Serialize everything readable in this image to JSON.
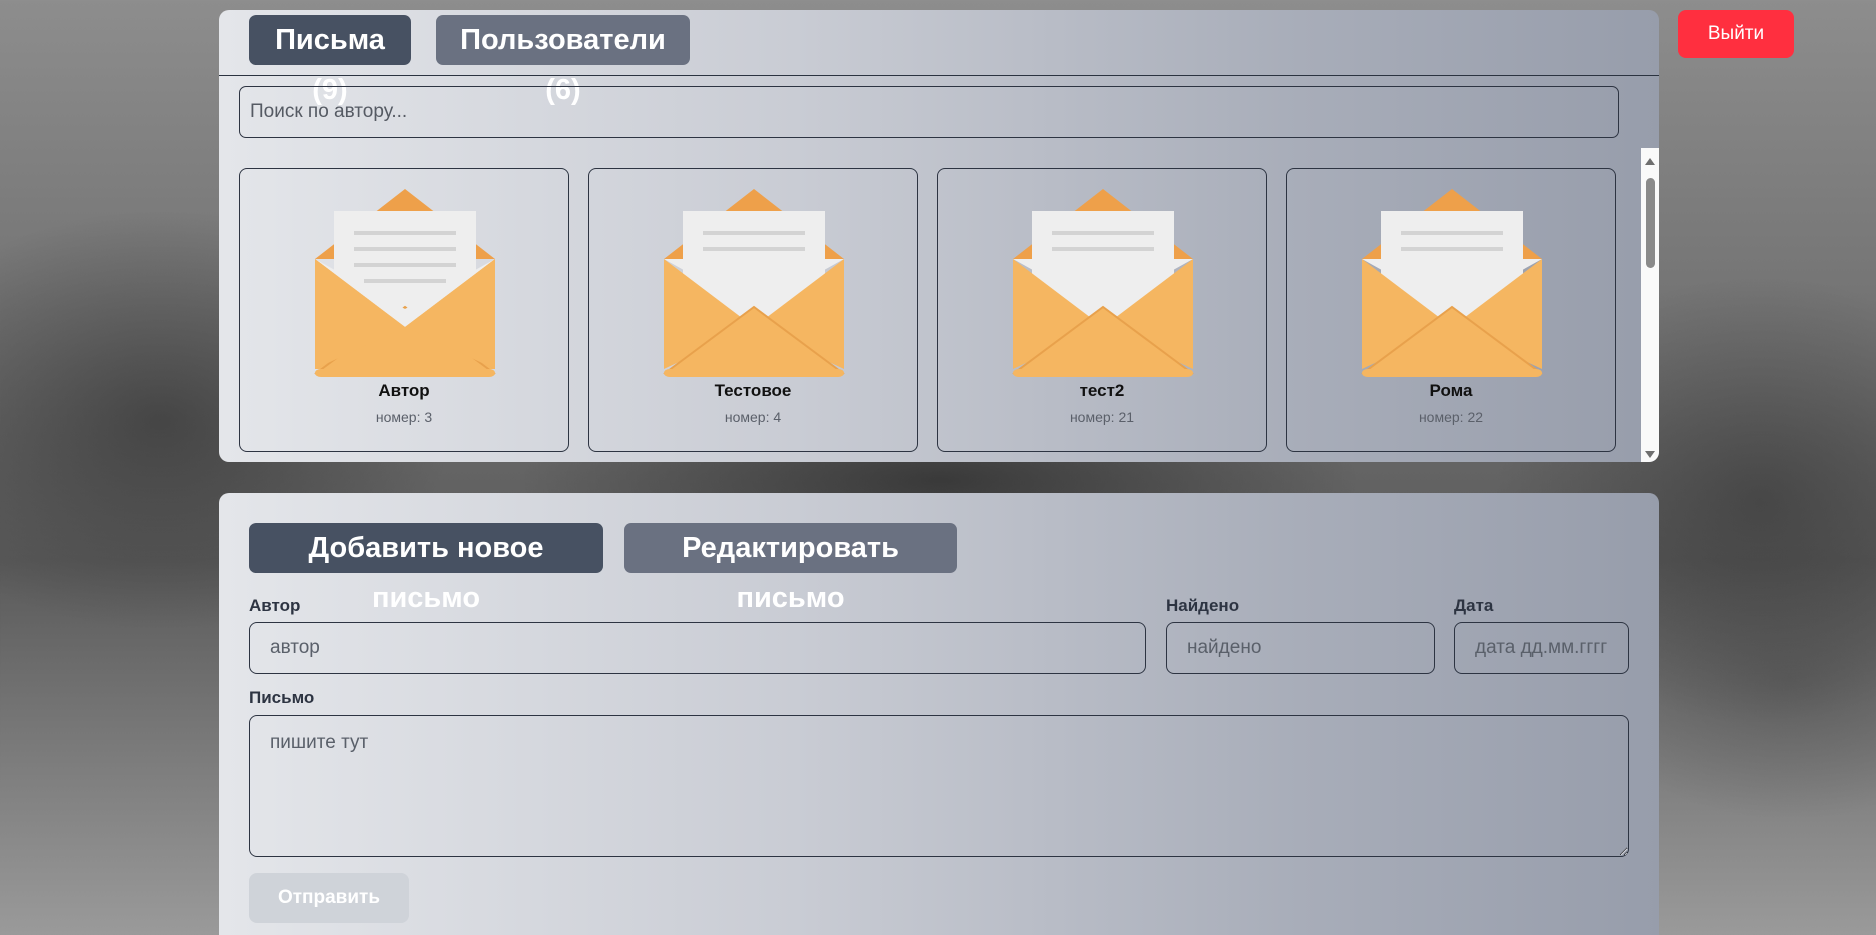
{
  "header": {
    "logout_label": "Выйти"
  },
  "top_panel": {
    "tabs": [
      {
        "label": "Письма (9)",
        "active": true
      },
      {
        "label": "Пользователи (6)",
        "active": false
      }
    ],
    "search": {
      "placeholder": "Поиск по автору...",
      "value": ""
    },
    "cards": [
      {
        "title": "Автор",
        "number": "номер: 3",
        "icon": "envelope-letter-icon"
      },
      {
        "title": "Тестовое",
        "number": "номер: 4",
        "icon": "envelope-letter-icon"
      },
      {
        "title": "тест2",
        "number": "номер: 21",
        "icon": "envelope-letter-icon"
      },
      {
        "title": "Рома",
        "number": "номер: 22",
        "icon": "envelope-letter-icon"
      }
    ]
  },
  "form_panel": {
    "tabs": [
      {
        "label": "Добавить новое письмо",
        "active": true
      },
      {
        "label": "Редактировать письмо",
        "active": false
      }
    ],
    "fields": {
      "author": {
        "label": "Автор",
        "placeholder": "автор",
        "value": ""
      },
      "found": {
        "label": "Найдено",
        "placeholder": "найдено",
        "value": ""
      },
      "date": {
        "label": "Дата",
        "placeholder": "дата дд.мм.гггг",
        "value": ""
      },
      "letter": {
        "label": "Письмо",
        "placeholder": "пишите тут",
        "value": ""
      }
    },
    "submit_label": "Отправить"
  },
  "colors": {
    "logout": "#ff2f3f",
    "active_tab": "#475162",
    "inactive_tab": "#6a7181",
    "envelope": "#f5b661"
  }
}
